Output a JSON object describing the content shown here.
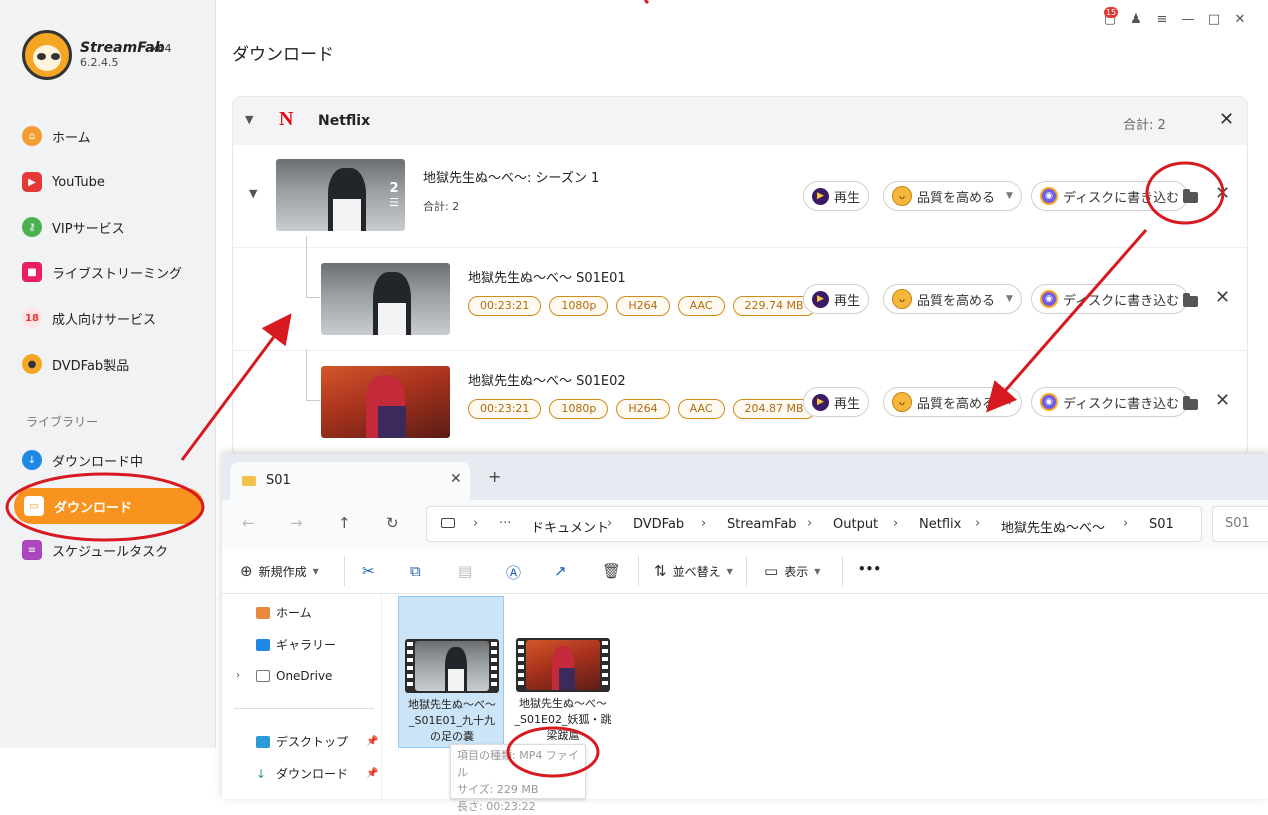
{
  "app": {
    "brand": "StreamFab",
    "edition": "x64",
    "version": "6.2.4.5",
    "notifications": "15"
  },
  "sidebar": {
    "items": [
      {
        "label": "ホーム",
        "color": "#f39c32"
      },
      {
        "label": "YouTube",
        "color": "#e53935"
      },
      {
        "label": "VIPサービス",
        "color": "#4caf50"
      },
      {
        "label": "ライブストリーミング",
        "color": "#e91e63"
      },
      {
        "label": "成人向けサービス",
        "color": "#e53935"
      },
      {
        "label": "DVDFab製品",
        "color": "#f5a623"
      }
    ],
    "library_title": "ライブラリー",
    "library": [
      {
        "label": "ダウンロード中",
        "color": "#1e88e5"
      },
      {
        "label": "ダウンロード",
        "color": "#ffffff"
      },
      {
        "label": "スケジュールタスク",
        "color": "#ab47bc"
      }
    ]
  },
  "main": {
    "title": "ダウンロード",
    "group": {
      "service": "Netflix",
      "logo": "N",
      "total": "合計: 2",
      "season": {
        "title": "地獄先生ぬ〜べ〜: シーズン 1",
        "sub": "合計: 2",
        "count": "2"
      },
      "episodes": [
        {
          "title": "地獄先生ぬ〜べ〜 S01E01",
          "chips": [
            "00:23:21",
            "1080p",
            "H264",
            "AAC",
            "229.74 MB"
          ]
        },
        {
          "title": "地獄先生ぬ〜べ〜 S01E02",
          "chips": [
            "00:23:21",
            "1080p",
            "H264",
            "AAC",
            "204.87 MB"
          ]
        }
      ],
      "buttons": {
        "play": "再生",
        "enhance": "品質を高める",
        "burn": "ディスクに書き込む"
      }
    }
  },
  "explorer": {
    "tab": "S01",
    "breadcrumbs": [
      "ドキュメント",
      "DVDFab",
      "StreamFab",
      "Output",
      "Netflix",
      "地獄先生ぬ〜べ〜",
      "S01"
    ],
    "search_placeholder": "S01",
    "toolbar": {
      "new": "新規作成",
      "sort": "並べ替え",
      "view": "表示",
      "more": "•••"
    },
    "side": [
      {
        "label": "ホーム",
        "color": "#e8883a"
      },
      {
        "label": "ギャラリー",
        "color": "#1e88e5"
      },
      {
        "label": "OneDrive",
        "color": "#ffffff"
      },
      {
        "label": "デスクトップ",
        "color": "#2a9bd8"
      },
      {
        "label": "ダウンロード",
        "color": "#2e9e5b"
      }
    ],
    "files": [
      {
        "line1": "地獄先生ぬ〜べ〜",
        "line2": "_S01E01_九十九",
        "line3": "の足の嚢"
      },
      {
        "line1": "地獄先生ぬ〜べ〜",
        "line2": "_S01E02_妖狐・跳",
        "line3": "梁跋扈"
      }
    ],
    "tooltip": {
      "type": "項目の種類: MP4 ファイル",
      "size": "サイズ: 229 MB",
      "length": "長さ: 00:23:22"
    }
  }
}
